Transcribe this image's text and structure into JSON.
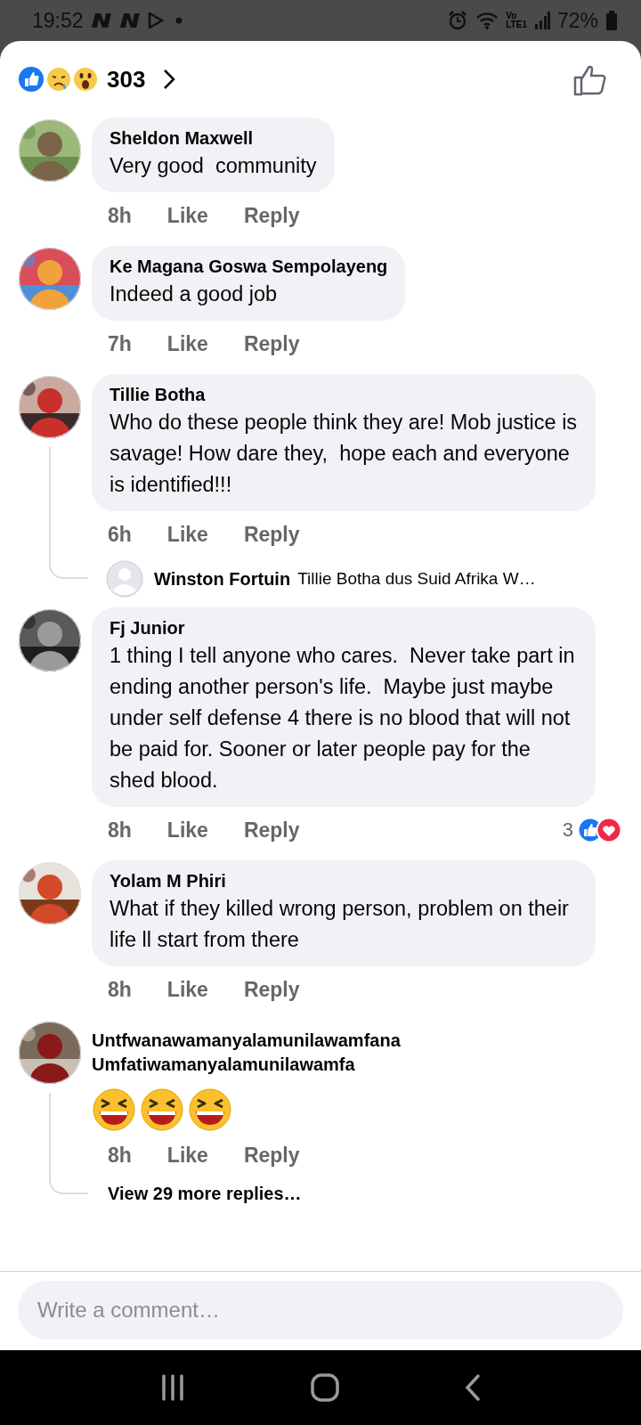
{
  "status_bar": {
    "time": "19:52",
    "network": [
      "Vo",
      "LTE1"
    ],
    "battery": "72%"
  },
  "header": {
    "reaction_count": "303"
  },
  "comments": [
    {
      "author": "Sheldon Maxwell",
      "text": "Very good  community",
      "time": "8h",
      "like": "Like",
      "reply": "Reply",
      "avatar": {
        "kind": "picture"
      }
    },
    {
      "author": "Ke Magana Goswa Sempolayeng",
      "text": "Indeed a good job",
      "time": "7h",
      "like": "Like",
      "reply": "Reply",
      "avatar": {
        "kind": "picture"
      }
    },
    {
      "author": "Tillie Botha",
      "text": "Who do these people think they are! Mob justice is savage! How dare they,  hope each and everyone is identified!!!",
      "time": "6h",
      "like": "Like",
      "reply": "Reply",
      "avatar": {
        "kind": "picture"
      },
      "replies": [
        {
          "author": "Winston Fortuin",
          "text": "Tillie Botha dus Suid Afrika W…"
        }
      ]
    },
    {
      "author": "Fj Junior",
      "text": "1 thing I tell anyone who cares.  Never take part in ending another person's life.  Maybe just maybe under self defense 4 there is no blood that will not be paid for. Sooner or later people pay for the shed blood.",
      "time": "8h",
      "like": "Like",
      "reply": "Reply",
      "avatar": {
        "kind": "picture"
      },
      "reaction_count": "3"
    },
    {
      "author": "Yolam M Phiri",
      "text": "What if they killed wrong person, problem on their life ll start from there",
      "time": "8h",
      "like": "Like",
      "reply": "Reply",
      "avatar": {
        "kind": "picture"
      }
    },
    {
      "author": "Untfwanawamanyalamunilawamfana Umfatiwamanyalamunilawamfa",
      "emojis": [
        {
          "kind": "laughing"
        },
        {
          "kind": "laughing"
        },
        {
          "kind": "laughing"
        }
      ],
      "time": "8h",
      "like": "Like",
      "reply": "Reply",
      "avatar": {
        "kind": "picture"
      },
      "view_more": "View 29 more replies…"
    }
  ],
  "composer": {
    "placeholder": "Write a comment…"
  }
}
